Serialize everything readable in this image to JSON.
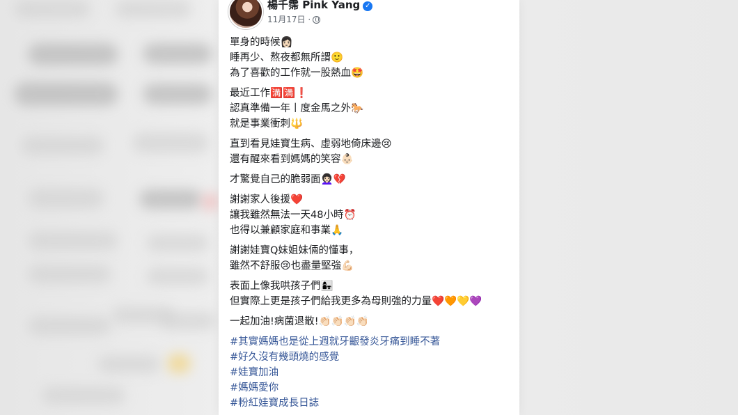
{
  "post": {
    "author": "楊千霈 Pink Yang",
    "date": "11月17日",
    "lines": [
      "單身的時候👩🏻",
      "睡再少、熬夜都無所謂🙂",
      "為了喜歡的工作就一股熱血🤩",
      "",
      "最近工作🈵🈵❗",
      "認真準備一年丨度金馬之外🐎",
      "就是事業衝刺🔱",
      "",
      "直到看見娃寶生病、虛弱地倚床邊😢",
      "還有醒來看到媽媽的笑容👶🏻",
      "",
      "才驚覺自己的脆弱面👩🏻‍🦱💔",
      "",
      "謝謝家人後援❤️",
      "讓我雖然無法一天48小時⏰",
      "也得以兼顧家庭和事業🙏",
      "",
      "謝謝娃寶Q妹姐妹倆的懂事，",
      "雖然不舒服😢也盡量堅強💪🏻",
      "",
      "表面上像我哄孩子們👩‍👧",
      "但實際上更是孩子們給我更多為母則強的力量❤️🧡💛💜",
      "",
      "一起加油!病菌退散!👏🏻👏🏻👏🏻👏🏻",
      ""
    ],
    "hashtags": [
      "#其實媽媽也是從上週就牙齦發炎牙痛到睡不著",
      "#好久沒有幾頭燒的感覺",
      "#娃寶加油",
      "#媽媽愛你",
      "#粉紅娃寶成長日誌"
    ]
  }
}
